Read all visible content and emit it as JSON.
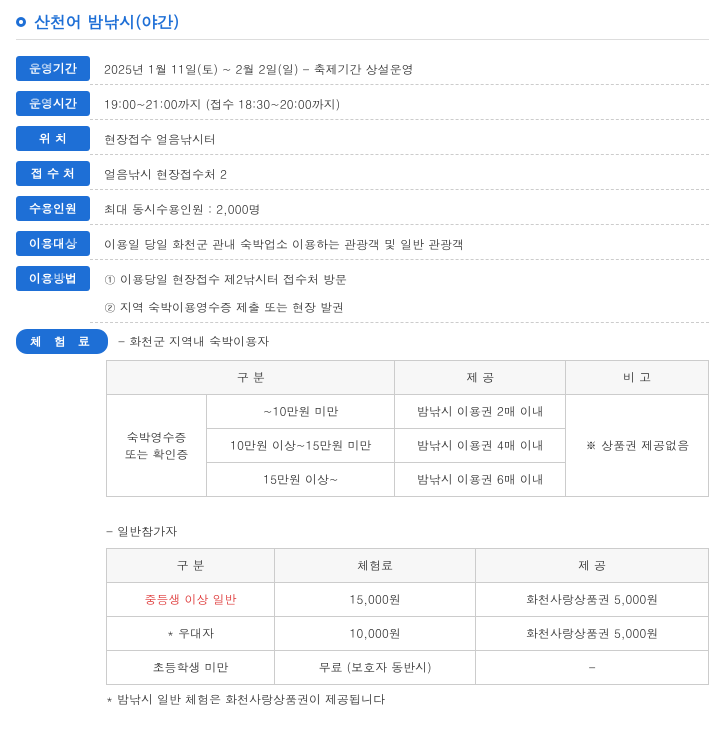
{
  "title": "산천어 밤낚시(야간)",
  "rows": {
    "period": {
      "label": "운영기간",
      "value": "2025년 1월 11일(토) ~ 2월 2일(일) - 축제기간 상설운영"
    },
    "hours": {
      "label": "운영시간",
      "value": "19:00~21:00까지 (접수 18:30~20:00까지)"
    },
    "location": {
      "label": "위      치",
      "value": "현장접수 얼음낚시터"
    },
    "register": {
      "label": "접 수 처",
      "value": "얼음낚시 현장접수처 2"
    },
    "capacity": {
      "label": "수용인원",
      "value": "최대 동시수용인원 : 2,000명"
    },
    "target": {
      "label": "이용대상",
      "value": "이용일 당일 화천군 관내 숙박업소 이용하는 관광객 및 일반 관광객"
    },
    "method": {
      "label": "이용방법",
      "line1": "① 이용당일 현장접수 제2낚시터 접수처 방문",
      "line2": "② 지역 숙박이용영수증 제출 또는 현장 발권"
    }
  },
  "fee": {
    "label": "체 험 료",
    "stay": {
      "heading": "- 화천군 지역내 숙박이용자",
      "headers": {
        "cat": "구 분",
        "provide": "제 공",
        "note": "비 고"
      },
      "rowhead": "숙박영수증\n또는 확인증",
      "r1": {
        "range": "~10만원 미만",
        "provide": "밤낚시 이용권 2매 이내"
      },
      "r2": {
        "range": "10만원 이상~15만원 미만",
        "provide": "밤낚시 이용권 4매 이내"
      },
      "r3": {
        "range": "15만원 이상~",
        "provide": "밤낚시 이용권 6매 이내"
      },
      "note": "※ 상품권 제공없음"
    },
    "general": {
      "heading": "- 일반참가자",
      "headers": {
        "cat": "구 분",
        "fee": "체험료",
        "provide": "제 공"
      },
      "r1": {
        "cat": "중등생 이상 일반",
        "fee": "15,000원",
        "provide": "화천사랑상품권 5,000원"
      },
      "r2": {
        "cat": "* 우대자",
        "fee": "10,000원",
        "provide": "화천사랑상품권 5,000원"
      },
      "r3": {
        "cat": "초등학생 미만",
        "fee": "무료 (보호자 동반시)",
        "provide": "-"
      },
      "footnote": "* 밤낚시 일반 체험은 화천사랑상품권이 제공됩니다"
    }
  }
}
